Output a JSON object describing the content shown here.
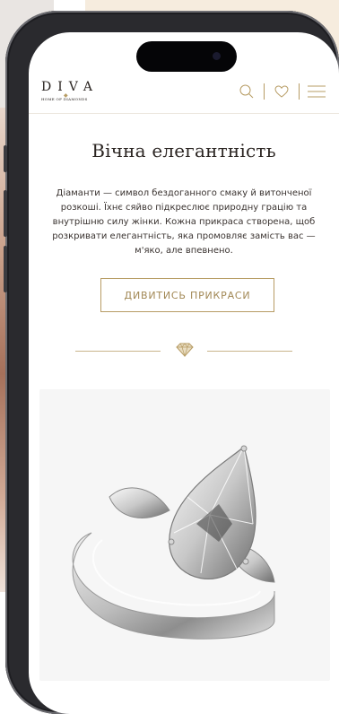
{
  "brand": {
    "logo": "DIVA",
    "tagline": "HOME OF DIAMONDS",
    "accent_color": "#b79c64"
  },
  "header": {
    "icons": [
      "search-icon",
      "heart-icon",
      "menu-icon"
    ]
  },
  "hero": {
    "title": "Вічна елегантність",
    "description": "Діаманти — символ бездоганного смаку й витонченої розкоші. Їхнє сяйво підкреслює природну грацію та внутрішню силу жінки. Кожна прикраса створена, щоб розкривати елегантність, яка промовляє замість вас — м'яко, але впевнено.",
    "cta_label": "ДИВИТИСЬ ПРИКРАСИ"
  },
  "divider": {
    "icon": "diamond-icon"
  },
  "product": {
    "image": "pear-diamond-ring-icon"
  }
}
